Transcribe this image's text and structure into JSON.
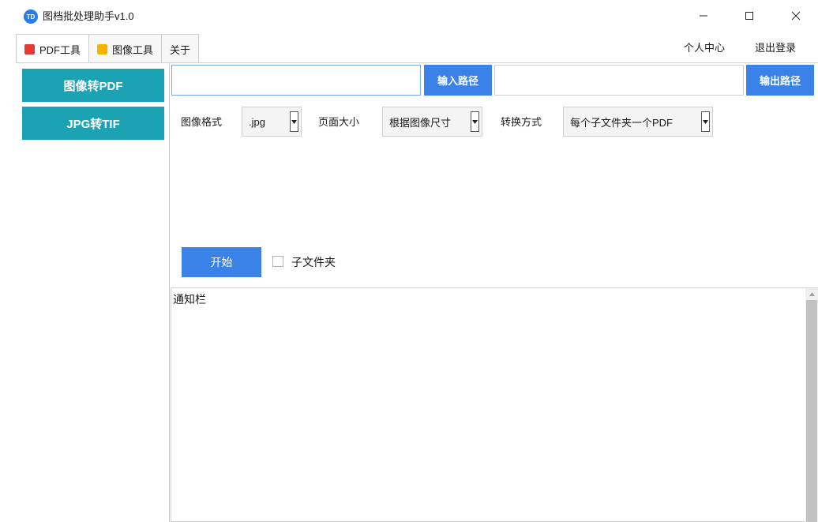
{
  "window": {
    "logo_text": "TD",
    "title": "图档批处理助手v1.0",
    "controls": [
      "minimize",
      "maximize",
      "close"
    ]
  },
  "tabs": [
    {
      "label": "PDF工具",
      "icon": "pdf-icon",
      "color": "#e53935"
    },
    {
      "label": "图像工具",
      "icon": "image-icon",
      "color": "#f5b400"
    },
    {
      "label": "关于",
      "icon": ""
    }
  ],
  "header_links": {
    "personal_center": "个人中心",
    "logout": "退出登录"
  },
  "sidebar": {
    "items": [
      {
        "label": "图像转PDF"
      },
      {
        "label": "JPG转TIF"
      }
    ],
    "button_color": "#1ba3b4"
  },
  "paths": {
    "input_value": "",
    "input_button": "输入路径",
    "output_value": "",
    "output_button": "输出路径"
  },
  "options": {
    "image_format_label": "图像格式",
    "image_format_value": ".jpg",
    "page_size_label": "页面大小",
    "page_size_value": "根据图像尺寸",
    "convert_mode_label": "转换方式",
    "convert_mode_value": "每个子文件夹一个PDF"
  },
  "actions": {
    "start": "开始",
    "subfolder_label": "子文件夹",
    "subfolder_checked": false
  },
  "notice": {
    "text": "通知栏"
  },
  "colors": {
    "accent_blue": "#3b82e8",
    "teal": "#1ba3b4"
  }
}
